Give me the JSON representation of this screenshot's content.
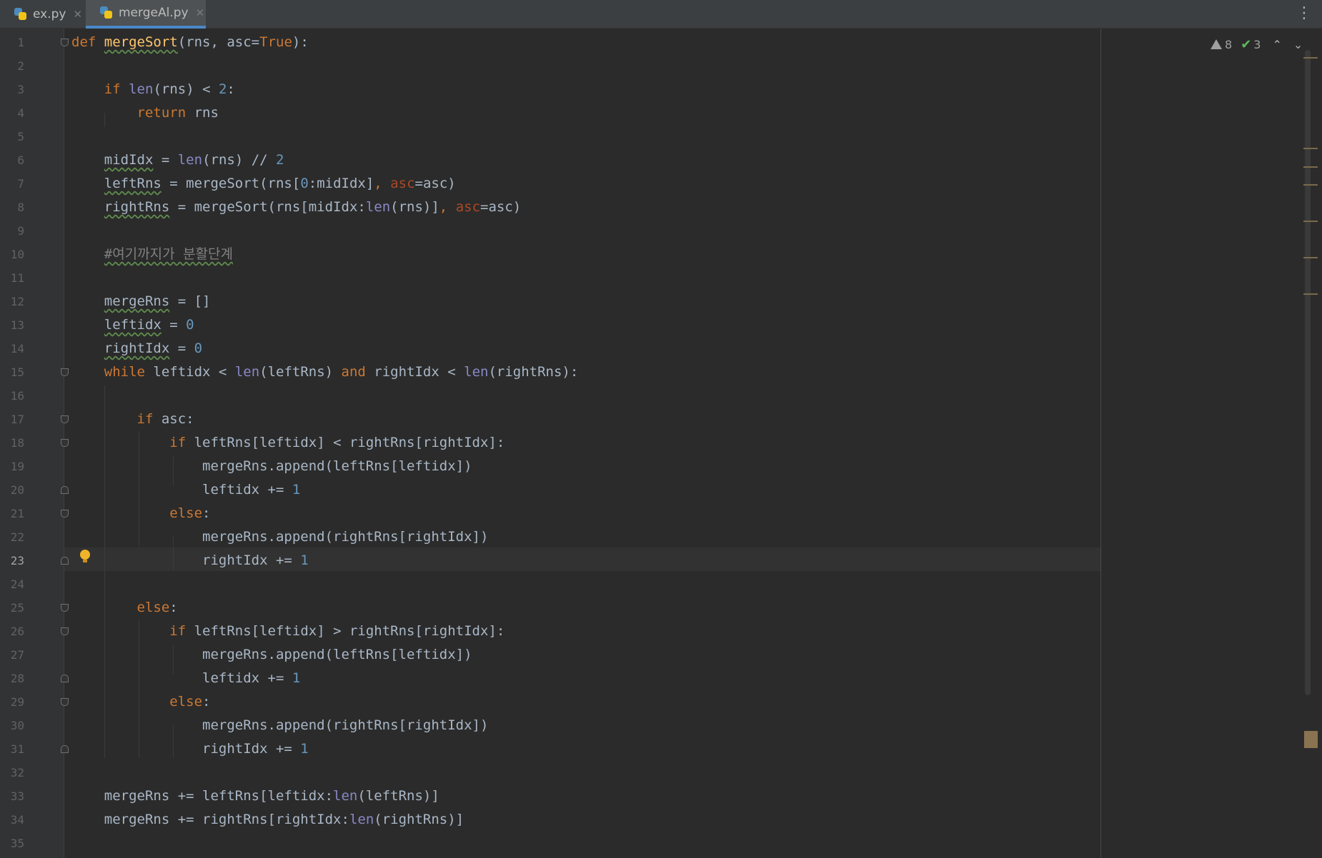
{
  "tabs": [
    {
      "label": "ex.py",
      "active": false,
      "icon": "python-file-icon"
    },
    {
      "label": "mergeAl.py",
      "active": true,
      "icon": "python-file-icon"
    }
  ],
  "inspections": {
    "warnings": "8",
    "typos": "3"
  },
  "caret_line": "23",
  "line_numbers": [
    "1",
    "2",
    "3",
    "4",
    "5",
    "6",
    "7",
    "8",
    "9",
    "10",
    "11",
    "12",
    "13",
    "14",
    "15",
    "16",
    "17",
    "18",
    "19",
    "20",
    "21",
    "22",
    "23",
    "24",
    "25",
    "26",
    "27",
    "28",
    "29",
    "30",
    "31",
    "32",
    "33",
    "34",
    "35"
  ],
  "code": [
    "def mergeSort(rns, asc=True):",
    "",
    "    if len(rns) < 2:",
    "        return rns",
    "",
    "    midIdx = len(rns) // 2",
    "    leftRns = mergeSort(rns[0:midIdx], asc=asc)",
    "    rightRns = mergeSort(rns[midIdx:len(rns)], asc=asc)",
    "",
    "    #여기까지가 분활단계",
    "",
    "    mergeRns = []",
    "    leftidx = 0",
    "    rightIdx = 0",
    "    while leftidx < len(leftRns) and rightIdx < len(rightRns):",
    "",
    "        if asc:",
    "            if leftRns[leftidx] < rightRns[rightIdx]:",
    "                mergeRns.append(leftRns[leftidx])",
    "                leftidx += 1",
    "            else:",
    "                mergeRns.append(rightRns[rightIdx])",
    "                rightIdx += 1",
    "",
    "        else:",
    "            if leftRns[leftidx] > rightRns[rightIdx]:",
    "                mergeRns.append(leftRns[leftidx])",
    "                leftidx += 1",
    "            else:",
    "                mergeRns.append(rightRns[rightIdx])",
    "                rightIdx += 1",
    "",
    "    mergeRns += leftRns[leftidx:len(leftRns)]",
    "    mergeRns += rightRns[rightIdx:len(rightRns)]",
    ""
  ],
  "colors": {
    "background": "#2b2b2b",
    "keyword": "#cc7832",
    "function": "#ffc66d",
    "builtin": "#8888c6",
    "number": "#6897bb",
    "comment": "#808080",
    "kwarg": "#aa4926",
    "text": "#a9b7c6"
  }
}
